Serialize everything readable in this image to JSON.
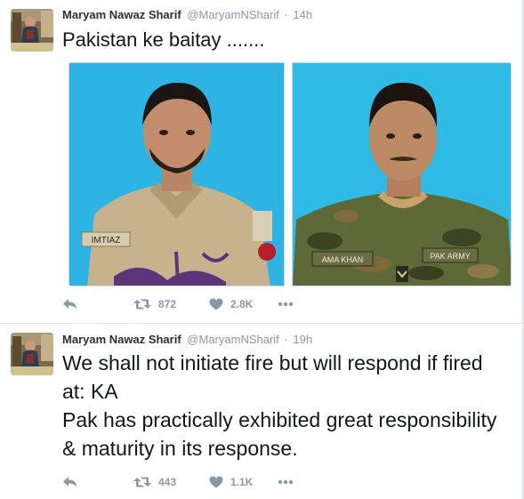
{
  "tweets": [
    {
      "fullname": "Maryam Nawaz Sharif",
      "username": "@MaryamNSharif",
      "separator": "·",
      "time": "14h",
      "text": "Pakistan ke baitay .......",
      "photos": [
        {
          "name_tag": "IMTIAZ",
          "subject": "soldier in khaki uniform"
        },
        {
          "name_tag": "AMA KHAN",
          "shoulder_tag": "PAK ARMY",
          "subject": "soldier in camouflage uniform"
        }
      ],
      "retweets": "872",
      "likes": "2.8K"
    },
    {
      "fullname": "Maryam Nawaz Sharif",
      "username": "@MaryamNSharif",
      "separator": "·",
      "time": "19h",
      "text_lines": [
        "We shall not initiate fire but will respond if fired at: KA",
        "Pak has practically exhibited great responsibility & maturity in its response."
      ],
      "retweets": "443",
      "likes": "1.1K"
    }
  ],
  "icons": {
    "reply": "reply-icon",
    "retweet": "retweet-icon",
    "like": "heart-icon",
    "more": "more-dots-icon"
  },
  "colors": {
    "icon_gray": "#8899a6",
    "text": "#14171a",
    "photo_bg": "#2fb6e3",
    "divider": "#e1e8ed"
  }
}
